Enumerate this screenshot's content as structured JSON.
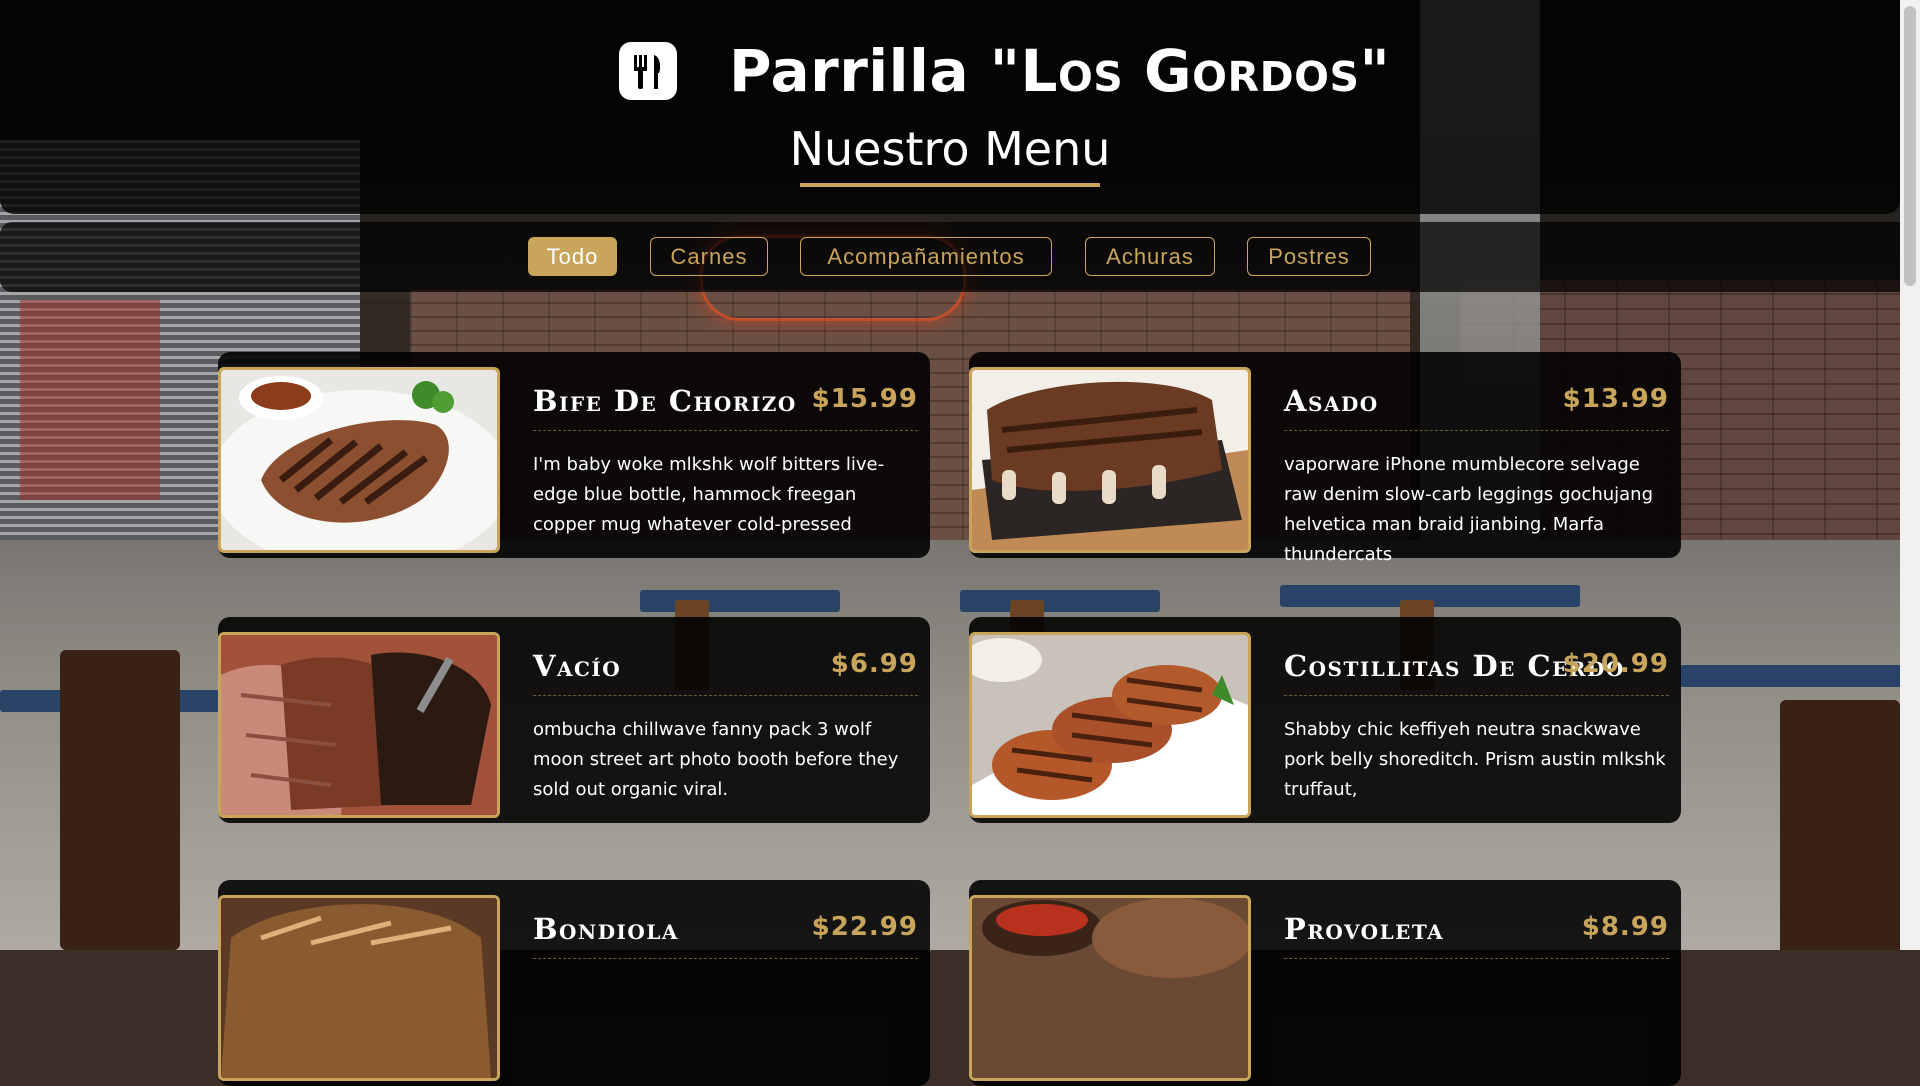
{
  "header": {
    "brand_name_prefix": "Parrilla \"",
    "brand_name_main": "Los Gordos",
    "brand_name_suffix": "\"",
    "logo_icon": "utensils-icon",
    "menu_title": "Nuestro Menu"
  },
  "filters": [
    {
      "label": "Todo",
      "active": true
    },
    {
      "label": "Carnes",
      "active": false
    },
    {
      "label": "Acompañamientos",
      "active": false
    },
    {
      "label": "Achuras",
      "active": false
    },
    {
      "label": "Postres",
      "active": false
    }
  ],
  "menu_items": [
    {
      "name": "Bife De Chorizo",
      "price": "$15.99",
      "description": "I'm baby woke mlkshk wolf bitters live-edge blue bottle, hammock freegan copper mug whatever cold-pressed"
    },
    {
      "name": "Asado",
      "price": "$13.99",
      "description": "vaporware iPhone mumblecore selvage raw denim slow-carb leggings gochujang helvetica man braid jianbing. Marfa thundercats"
    },
    {
      "name": "Vacío",
      "price": "$6.99",
      "description": "ombucha chillwave fanny pack 3 wolf moon street art photo booth before they sold out organic viral."
    },
    {
      "name": "Costillitas De Cerdo",
      "price": "$20.99",
      "description": "Shabby chic keffiyeh neutra snackwave pork belly shoreditch. Prism austin mlkshk truffaut,"
    },
    {
      "name": "Bondiola",
      "price": "$22.99",
      "description": ""
    },
    {
      "name": "Provoleta",
      "price": "$8.99",
      "description": ""
    }
  ],
  "colors": {
    "accent": "#c9a55c",
    "header_bg": "#000000",
    "text": "#ffffff"
  }
}
